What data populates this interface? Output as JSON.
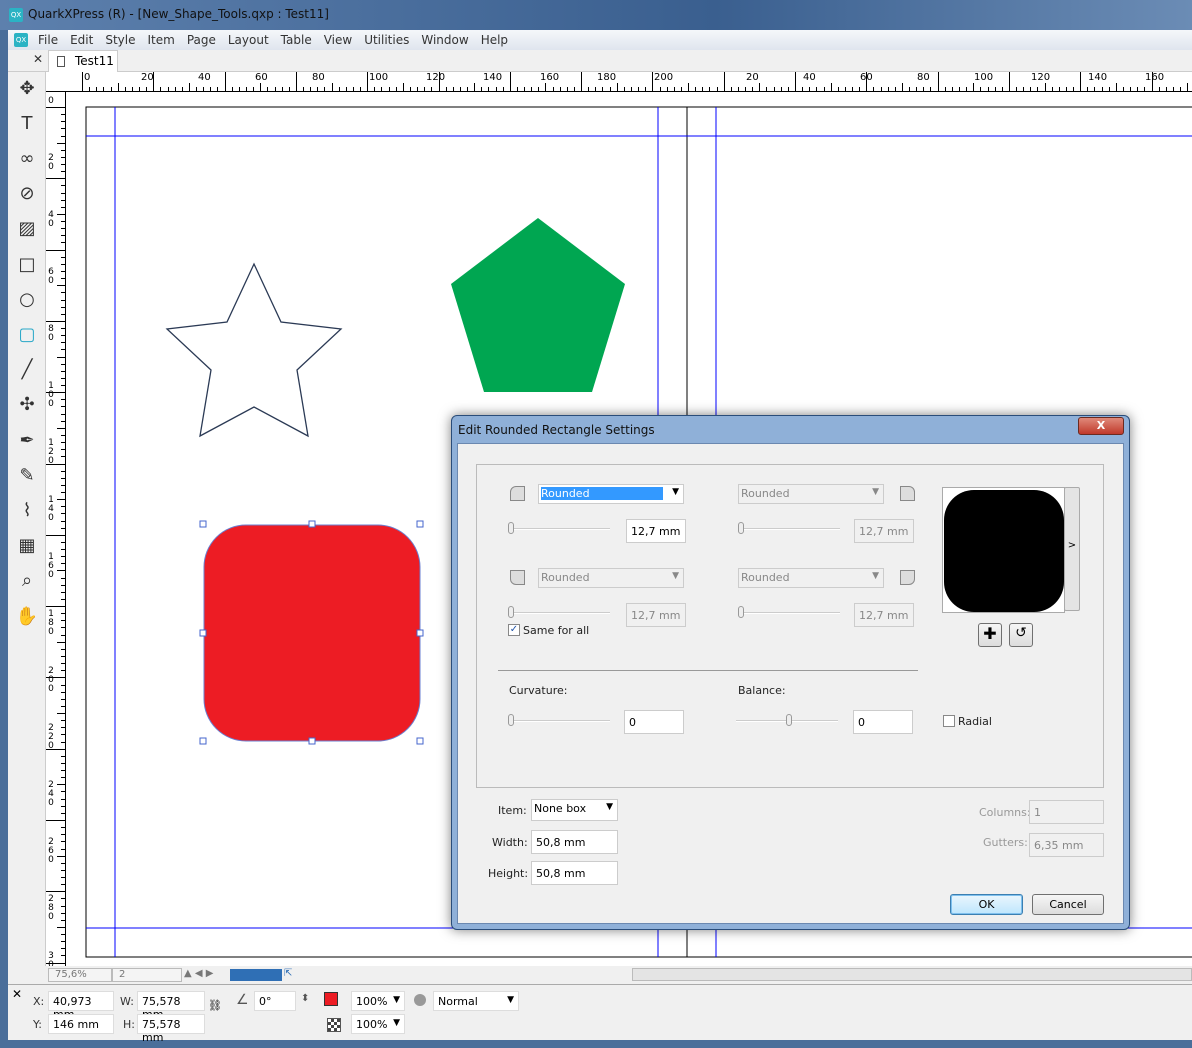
{
  "window": {
    "title": "QuarkXPress (R) - [New_Shape_Tools.qxp : Test11]",
    "icon": "qx-app-icon"
  },
  "menu": [
    "File",
    "Edit",
    "Style",
    "Item",
    "Page",
    "Layout",
    "Table",
    "View",
    "Utilities",
    "Window",
    "Help"
  ],
  "tab": {
    "label": "Test11"
  },
  "tools": [
    "move-icon",
    "text-icon",
    "linked-text-icon",
    "unlink-icon",
    "picture-icon",
    "rectangle-icon",
    "oval-icon",
    "rounded-rect-icon",
    "line-icon",
    "star-shape-icon",
    "pen-icon",
    "pencil-icon",
    "eyedropper-icon",
    "table-icon",
    "zoom-icon",
    "hand-icon"
  ],
  "rulers": {
    "top": [
      "0",
      "20",
      "40",
      "60",
      "80",
      "100",
      "120",
      "140",
      "160",
      "180",
      "200",
      "20",
      "40",
      "60",
      "80",
      "100",
      "120",
      "140",
      "160",
      "18"
    ],
    "left": [
      "0",
      "20",
      "40",
      "60",
      "80",
      "100",
      "120",
      "140",
      "160",
      "180",
      "200",
      "220",
      "240",
      "260",
      "280",
      "300"
    ]
  },
  "shapes": {
    "star_stroke": "#2b3a55",
    "pentagon_fill": "#00a651",
    "rect_fill": "#ed1c24",
    "guide_color": "#0000ff"
  },
  "status": {
    "zoom": "75,6%",
    "page": "2"
  },
  "measurements": {
    "x_label": "X:",
    "x": "40,973 mm",
    "y_label": "Y:",
    "y": "146 mm",
    "w_label": "W:",
    "w": "75,578 mm",
    "h_label": "H:",
    "h": "75,578 mm",
    "angle": "0°",
    "color": "#ed1c24",
    "opacity": "100%",
    "shade": "100%",
    "blend": "Normal"
  },
  "dialog": {
    "title": "Edit Rounded Rectangle Settings",
    "corners": [
      {
        "style": "Rounded",
        "value": "12,7 mm",
        "enabled": true
      },
      {
        "style": "Rounded",
        "value": "12,7 mm",
        "enabled": false
      },
      {
        "style": "Rounded",
        "value": "12,7 mm",
        "enabled": false
      },
      {
        "style": "Rounded",
        "value": "12,7 mm",
        "enabled": false
      }
    ],
    "same_for_all": "Same for all",
    "same_for_all_checked": true,
    "curvature_label": "Curvature:",
    "curvature": "0",
    "balance_label": "Balance:",
    "balance": "0",
    "radial": "Radial",
    "radial_checked": false,
    "item_label": "Item:",
    "item": "None box",
    "width_label": "Width:",
    "width": "50,8 mm",
    "height_label": "Height:",
    "height": "50,8 mm",
    "columns_label": "Columns:",
    "columns": "1",
    "gutters_label": "Gutters:",
    "gutters": "6,35 mm",
    "ok": "OK",
    "cancel": "Cancel",
    "close": "X",
    "expand": ">"
  }
}
